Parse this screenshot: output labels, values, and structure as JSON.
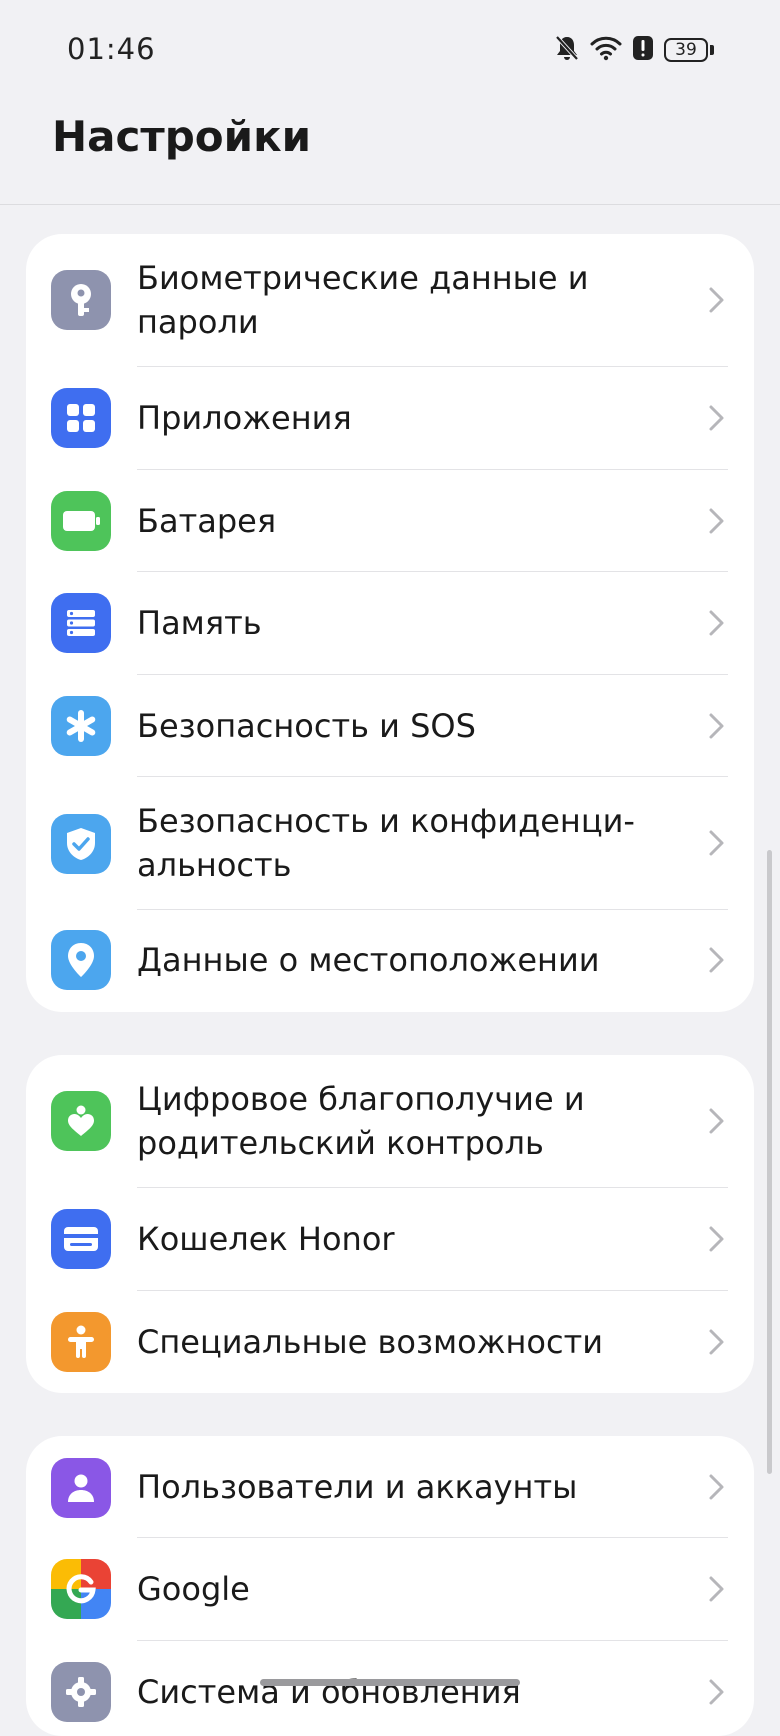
{
  "status_bar": {
    "time": "01:46",
    "battery_level": "39",
    "icons": [
      "bell-off-icon",
      "wifi-icon",
      "alert-icon",
      "battery-icon"
    ]
  },
  "header": {
    "title": "Настройки"
  },
  "groups": [
    {
      "items": [
        {
          "label": "Биометрические данные и пароли",
          "icon": "key-icon",
          "color": "#8e93ae"
        },
        {
          "label": "Приложения",
          "icon": "apps-grid-icon",
          "color": "#3f6ef0"
        },
        {
          "label": "Батарея",
          "icon": "battery-icon",
          "color": "#4ec45a"
        },
        {
          "label": "Память",
          "icon": "storage-icon",
          "color": "#3f6ef0"
        },
        {
          "label": "Безопасность и SOS",
          "icon": "asterisk-icon",
          "color": "#4ca6ee"
        },
        {
          "label": "Безопасность и конфиденци-альность",
          "icon": "shield-check-icon",
          "color": "#4ca6ee"
        },
        {
          "label": "Данные о местоположении",
          "icon": "location-pin-icon",
          "color": "#4ca6ee"
        }
      ]
    },
    {
      "items": [
        {
          "label": "Цифровое благополучие и родительский контроль",
          "icon": "heart-person-icon",
          "color": "#4ec45a"
        },
        {
          "label": "Кошелек Honor",
          "icon": "wallet-icon",
          "color": "#3f6ef0"
        },
        {
          "label": "Специальные возможности",
          "icon": "accessibility-icon",
          "color": "#f3982e"
        }
      ]
    },
    {
      "items": [
        {
          "label": "Пользователи и аккаунты",
          "icon": "user-icon",
          "color": "#8a57e6"
        },
        {
          "label": "Google",
          "icon": "google-icon",
          "color": "#4285f4"
        },
        {
          "label": "Система и обновления",
          "icon": "gear-icon",
          "color": "#8e93ae"
        }
      ]
    }
  ]
}
